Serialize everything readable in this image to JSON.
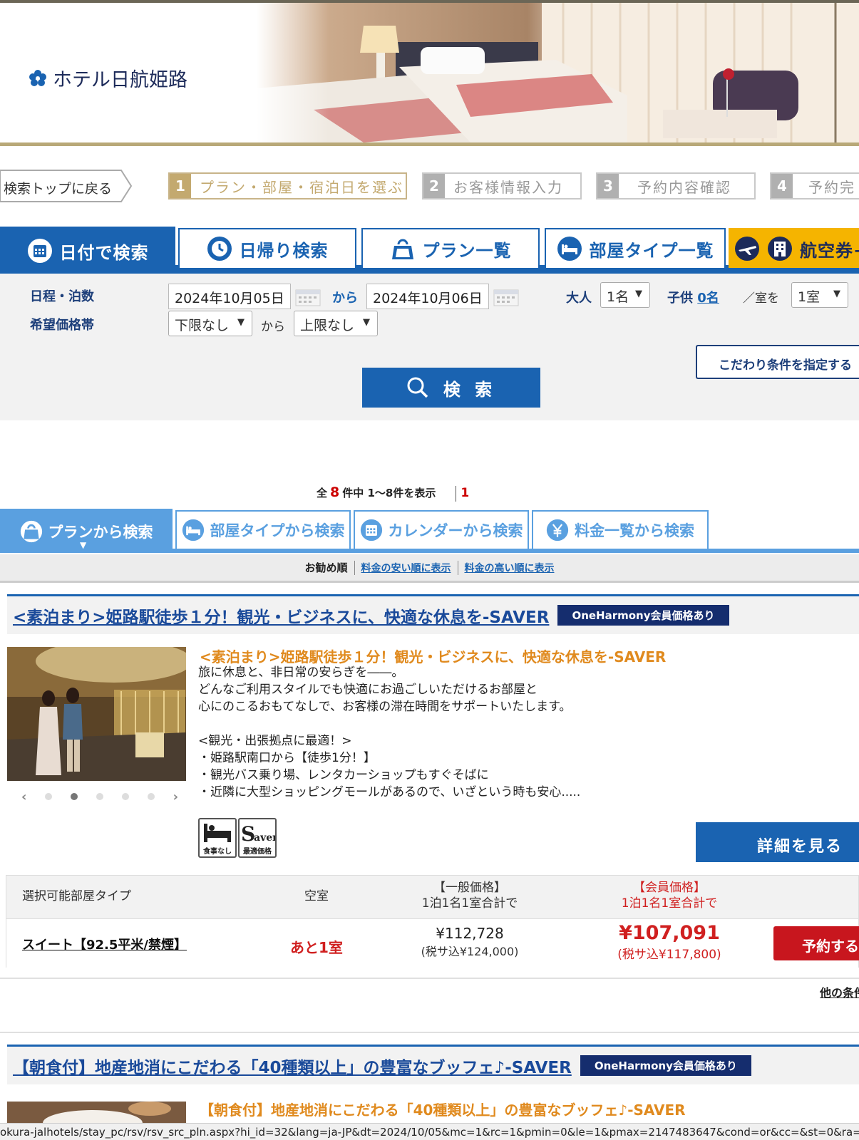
{
  "hotel": {
    "name": "ホテル日航姫路"
  },
  "nav": {
    "back_label": "検索トップに戻る"
  },
  "steps": [
    {
      "num": "1",
      "label": "プラン・部屋・宿泊日を選ぶ"
    },
    {
      "num": "2",
      "label": "お客様情報入力"
    },
    {
      "num": "3",
      "label": "予約内容確認"
    },
    {
      "num": "4",
      "label": "予約完"
    }
  ],
  "search_tabs": [
    {
      "label": "日付で検索",
      "icon": "calendar-icon"
    },
    {
      "label": "日帰り検索",
      "icon": "clock-icon"
    },
    {
      "label": "プラン一覧",
      "icon": "bag-icon"
    },
    {
      "label": "部屋タイプ一覧",
      "icon": "bed-icon"
    },
    {
      "label": "航空券+",
      "icon": "airplane-icon"
    }
  ],
  "search": {
    "dates_label": "日程・泊数",
    "checkin": "2024年10月05日",
    "from": "から",
    "checkout": "2024年10月06日",
    "adults_label": "大人",
    "adults_value": "1名",
    "children_label": "子供",
    "children_value": "0名",
    "per_room": "／室を",
    "rooms_value": "1室",
    "price_label": "希望価格帯",
    "price_min": "下限なし",
    "price_from": "から",
    "price_max": "上限なし",
    "kodawari": "こだわり条件を指定する",
    "search_button": "検 索"
  },
  "results": {
    "prefix": "全",
    "total": "8",
    "suffix": "件中 1～8件を表示",
    "page": "1"
  },
  "result_tabs": [
    {
      "label": "プランから検索",
      "icon": "bag-icon"
    },
    {
      "label": "部屋タイプから検索",
      "icon": "bed-icon"
    },
    {
      "label": "カレンダーから検索",
      "icon": "calendar-icon"
    },
    {
      "label": "料金一覧から検索",
      "icon": "yen-icon"
    }
  ],
  "sort": {
    "current": "お勧め順",
    "cheap": "料金の安い順に表示",
    "expensive": "料金の高い順に表示"
  },
  "plans": [
    {
      "title": "<素泊まり>姫路駅徒歩１分！観光・ビジネスに、快適な休息を-SAVER",
      "badge": "OneHarmony会員価格あり",
      "subtitle": "<素泊まり>姫路駅徒歩１分！観光・ビジネスに、快適な休息を-SAVER",
      "description": [
        "旅に休息と、非日常の安らぎを――。",
        "どんなご利用スタイルでも快適にお過ごしいただけるお部屋と",
        "心にのこるおもてなしで、お客様の滞在時間をサポートいたします。",
        "",
        "<観光・出張拠点に最適！>",
        "・姫路駅南口から【徒歩1分！】",
        "・観光バス乗り場、レンタカーショップもすぐそばに",
        "・近隣に大型ショッピングモールがあるので、いざという時も安心....."
      ],
      "features": [
        {
          "caption": "食事なし",
          "icon": "bed-icon"
        },
        {
          "caption": "最適価格",
          "icon": "saver-icon"
        }
      ],
      "detail_button": "詳細を見る",
      "table": {
        "col_room": "選択可能部屋タイプ",
        "col_avail": "空室",
        "col_general_1": "【一般価格】",
        "col_general_2": "1泊1名1室合計で",
        "col_member_1": "【会員価格】",
        "col_member_2": "1泊1名1室合計で",
        "room": "スイート【92.5平米/禁煙】",
        "avail": "あと1室",
        "general_price": "¥112,728",
        "general_tax": "(税サ込¥124,000)",
        "member_price": "¥107,091",
        "member_tax": "(税サ込¥117,800)",
        "reserve": "予約する"
      },
      "other": "他の条件"
    },
    {
      "title": "【朝食付】地産地消にこだわる「40種類以上」の豊富なブッフェ♪-SAVER",
      "badge": "OneHarmony会員価格あり",
      "subtitle": "【朝食付】地産地消にこだわる「40種類以上」の豊富なブッフェ♪-SAVER"
    }
  ],
  "status_url": "okura-jalhotels/stay_pc/rsv/rsv_src_pln.aspx?hi_id=32&lang=ja-JP&dt=2024/10/05&mc=1&rc=1&pmin=0&le=1&pmax=2147483647&cond=or&cc=&st=0&ra=&d",
  "colors": {
    "primary": "#1a63b1",
    "accent_gold": "#c3a96f",
    "flight_tab": "#f5b400",
    "price_red": "#d02020",
    "reserve_red": "#c8161e"
  }
}
